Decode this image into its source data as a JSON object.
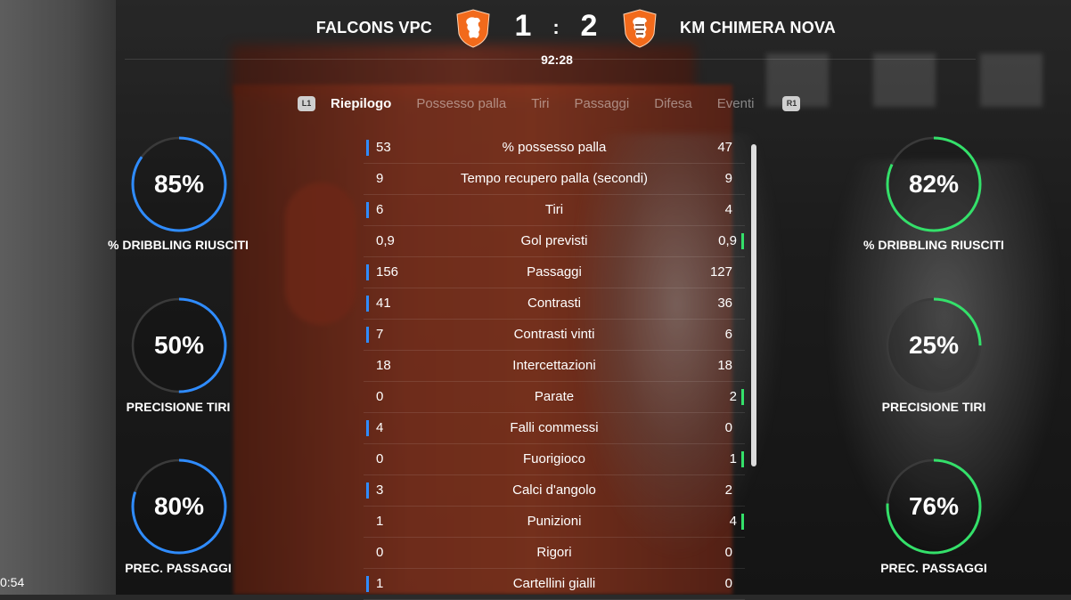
{
  "header": {
    "home_team": "FALCONS VPC",
    "away_team": "KM CHIMERA NOVA",
    "home_score": "1",
    "separator": ":",
    "away_score": "2",
    "clock": "92:28",
    "home_crest_icon": "lion-crest-icon",
    "away_crest_icon": "lion-crest-icon",
    "crest_color": "#f26a1b"
  },
  "tabs": {
    "left_bumper": "L1",
    "right_bumper": "R1",
    "items": [
      "Riepilogo",
      "Possesso palla",
      "Tiri",
      "Passaggi",
      "Difesa",
      "Eventi"
    ],
    "active": "Riepilogo"
  },
  "gauges_home": [
    {
      "value": "85%",
      "label": "% DRIBBLING RIUSCITI",
      "fraction": 0.85
    },
    {
      "value": "50%",
      "label": "PRECISIONE TIRI",
      "fraction": 0.5
    },
    {
      "value": "80%",
      "label": "PREC. PASSAGGI",
      "fraction": 0.8
    }
  ],
  "gauges_away": [
    {
      "value": "82%",
      "label": "% DRIBBLING RIUSCITI",
      "fraction": 0.82
    },
    {
      "value": "25%",
      "label": "PRECISIONE TIRI",
      "fraction": 0.25
    },
    {
      "value": "76%",
      "label": "PREC. PASSAGGI",
      "fraction": 0.76
    }
  ],
  "colors": {
    "home_accent": "#2f8cff",
    "away_accent": "#34e06a",
    "track": "#3a3a3a"
  },
  "stats": [
    {
      "name": "% possesso palla",
      "home": "53",
      "away": "47",
      "leader": "home"
    },
    {
      "name": "Tempo recupero palla (secondi)",
      "home": "9",
      "away": "9",
      "leader": "none"
    },
    {
      "name": "Tiri",
      "home": "6",
      "away": "4",
      "leader": "home"
    },
    {
      "name": "Gol previsti",
      "home": "0,9",
      "away": "0,9",
      "leader": "away"
    },
    {
      "name": "Passaggi",
      "home": "156",
      "away": "127",
      "leader": "home"
    },
    {
      "name": "Contrasti",
      "home": "41",
      "away": "36",
      "leader": "home"
    },
    {
      "name": "Contrasti vinti",
      "home": "7",
      "away": "6",
      "leader": "home"
    },
    {
      "name": "Intercettazioni",
      "home": "18",
      "away": "18",
      "leader": "none"
    },
    {
      "name": "Parate",
      "home": "0",
      "away": "2",
      "leader": "away"
    },
    {
      "name": "Falli commessi",
      "home": "4",
      "away": "0",
      "leader": "home"
    },
    {
      "name": "Fuorigioco",
      "home": "0",
      "away": "1",
      "leader": "away"
    },
    {
      "name": "Calci d'angolo",
      "home": "3",
      "away": "2",
      "leader": "home"
    },
    {
      "name": "Punizioni",
      "home": "1",
      "away": "4",
      "leader": "away"
    },
    {
      "name": "Rigori",
      "home": "0",
      "away": "0",
      "leader": "none"
    },
    {
      "name": "Cartellini gialli",
      "home": "1",
      "away": "0",
      "leader": "home"
    }
  ],
  "corner_time": "0:54"
}
